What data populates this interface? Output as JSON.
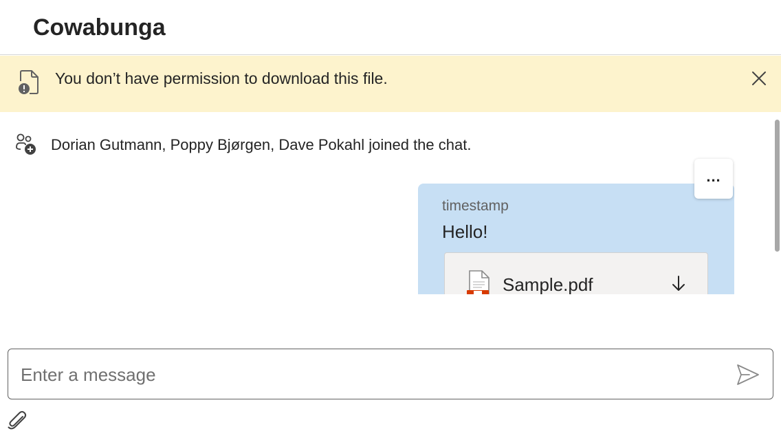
{
  "header": {
    "title": "Cowabunga"
  },
  "banner": {
    "message": "You don’t have permission to download this file.",
    "icon": "document-warning-icon",
    "close_icon": "close-icon"
  },
  "system_message": {
    "icon": "people-add-icon",
    "text": "Dorian Gutmann, Poppy Bjørgen, Dave Pokahl joined the chat."
  },
  "message": {
    "timestamp": "timestamp",
    "text": "Hello!",
    "more_options_label": "...",
    "attachment": {
      "name": "Sample.pdf",
      "icon": "pdf-file-icon",
      "download_icon": "arrow-down-icon"
    }
  },
  "composer": {
    "placeholder": "Enter a message",
    "value": "",
    "send_icon": "send-icon",
    "attach_icon": "paperclip-icon"
  },
  "colors": {
    "banner_background": "#fdf3cd",
    "bubble_background": "#c7dff4",
    "pdf_accent": "#d83b01"
  }
}
